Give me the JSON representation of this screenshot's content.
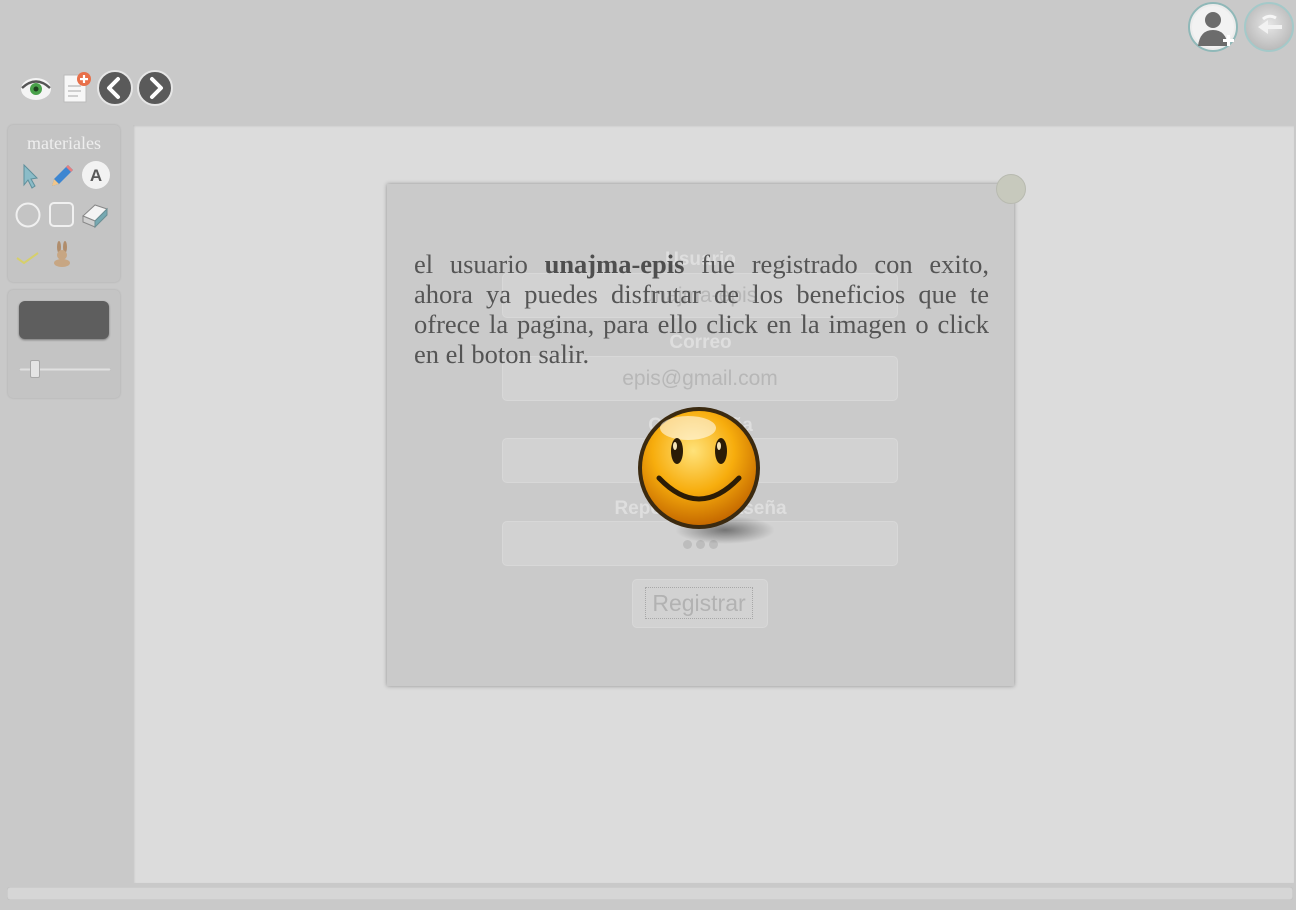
{
  "header": {
    "add_user_icon": "add-user-icon",
    "exit_icon": "exit-icon"
  },
  "toolbar": {
    "icons": [
      "eye-icon",
      "new-page-icon",
      "arrow-left-icon",
      "arrow-right-icon"
    ]
  },
  "materials": {
    "title": "materiales",
    "text_tool_label": "A",
    "tools": [
      "pointer-icon",
      "pencil-icon",
      "text-icon",
      "circle-icon",
      "rounded-rect-icon",
      "eraser-icon",
      "check-icon",
      "rabbit-icon"
    ]
  },
  "colors": {
    "selected_color": "#5e5e5e",
    "canvas": "#dcdcdc",
    "background": "#c9c9c9",
    "text": "#555555"
  },
  "form": {
    "user_label": "Usuario",
    "user_value": "unajma-epis",
    "email_label": "Correo",
    "email_value": "epis@gmail.com",
    "password_label": "Contraseña",
    "repeat_password_label": "Repetir contraseña",
    "register_label": "Registrar"
  },
  "message": {
    "part1": "el usuario ",
    "username": "unajma-epis",
    "part2": " fue registrado con exito, ahora ya puedes disfrutar de los beneficios que te ofrece la pagina, para ello click en la imagen o click en el boton salir."
  }
}
